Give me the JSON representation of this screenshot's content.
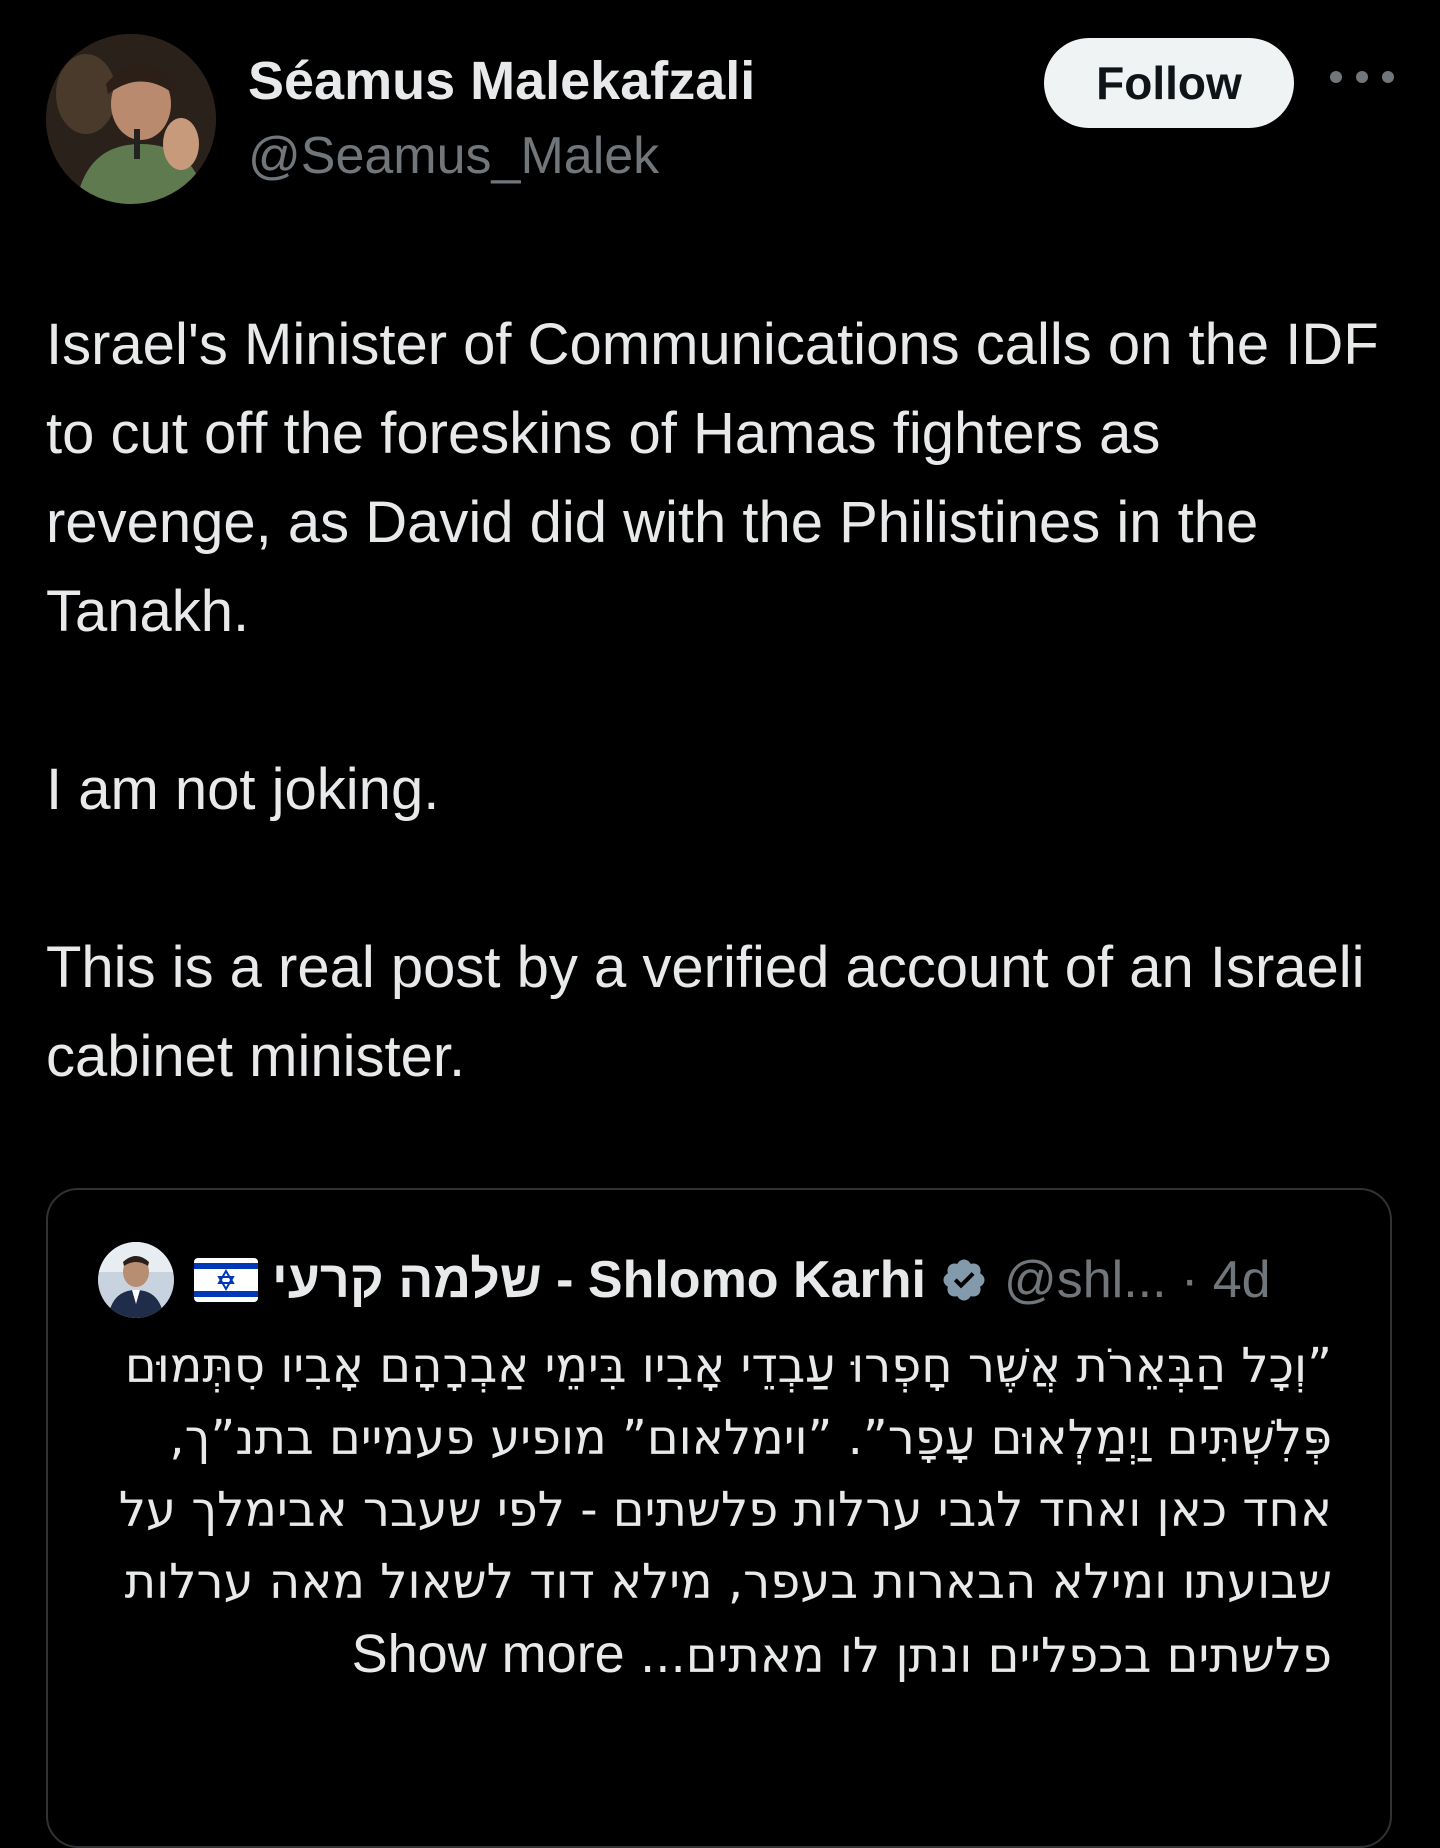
{
  "author": {
    "name": "Séamus Malekafzali",
    "handle": "@Seamus_Malek"
  },
  "follow_label": "Follow",
  "tweet": {
    "paragraphs": [
      "Israel's Minister of Communications calls on the IDF to cut off the foreskins of Hamas fighters as revenge, as David did with the Philistines in the Tanakh.",
      "I am not joking.",
      "This is a real post by a verified account of an Israeli cabinet minister."
    ]
  },
  "quoted": {
    "name": "שלמה קרעי - Shlomo Karhi",
    "handle": "@shl... · 4d",
    "text": "”וְכָל הַבְּאֵרֹת אֲשֶׁר חָפְרוּ עַבְדֵי אָבִיו בִּימֵי אַבְרָהָם אָבִיו סִתְּמוּם פְּלִשְׁתִּים וַיְמַלְאוּם עָפָר”. ”וימלאום” מופיע פעמיים בתנ”ך, אחד כאן ואחד לגבי ערלות פלשתים - לפי שעבר אבימלך על שבועתו ומילא הבארות בעפר, מילא דוד לשאול מאה ערלות פלשתים בכפליים ונתן לו מאתים...",
    "show_more": "Show more"
  },
  "icons": {
    "more": "more-horizontal-icon",
    "verified": "verified-badge-icon",
    "flag": "israel-flag-icon"
  },
  "colors": {
    "background": "#000000",
    "text": "#e7e9ea",
    "muted": "#71767b",
    "border": "#2f3336",
    "follow_bg": "#eff3f4",
    "verified_badge": "#829aab"
  }
}
